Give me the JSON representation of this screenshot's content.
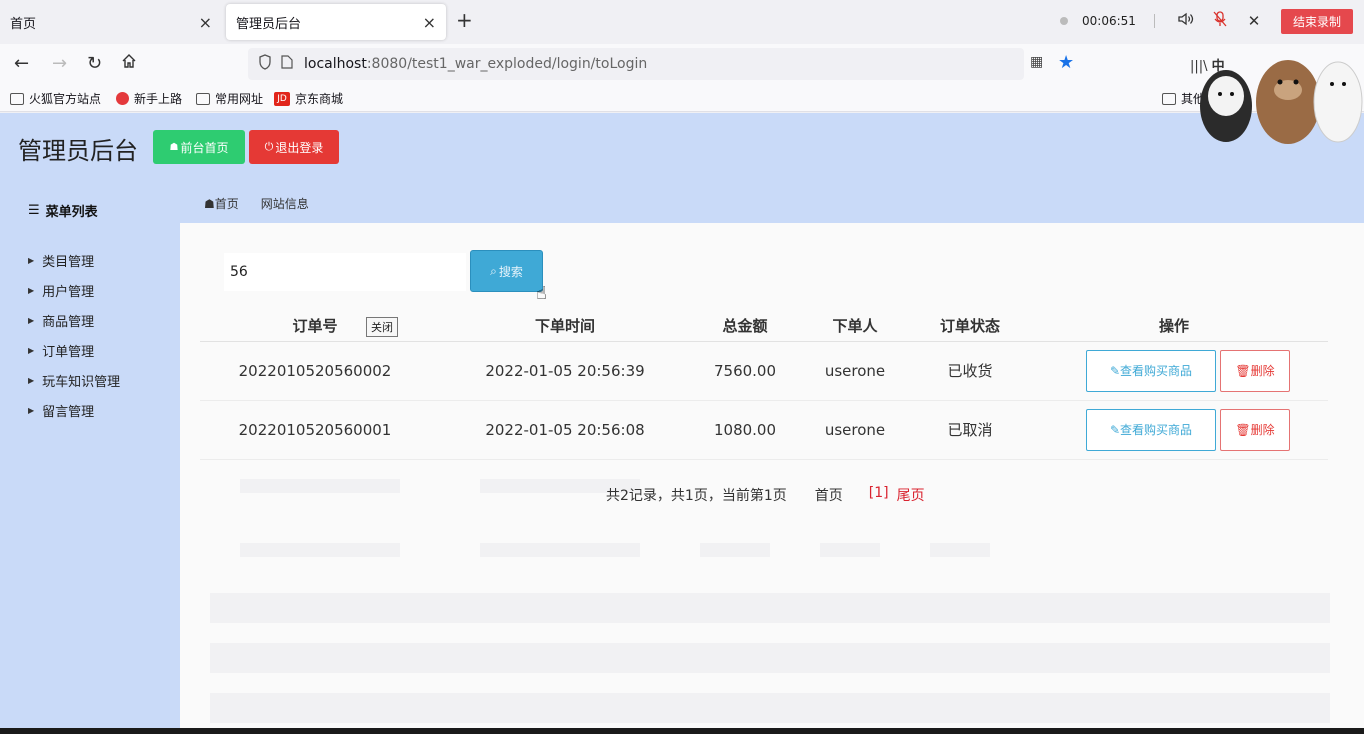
{
  "browser": {
    "tabs": [
      {
        "label": "首页",
        "active": false
      },
      {
        "label": "管理员后台",
        "active": true
      }
    ],
    "recording": {
      "time": "00:06:51",
      "stop_label": "结束录制"
    },
    "url": {
      "host": "localhost",
      "rest": ":8080/test1_war_exploded/login/toLogin"
    },
    "library_label": "中",
    "bookmarks": [
      "火狐官方站点",
      "新手上路",
      "常用网址",
      "京东商城"
    ],
    "other_bookmarks": "其他书签"
  },
  "header": {
    "title": "管理员后台",
    "home_button": "前台首页",
    "logout_button": "退出登录"
  },
  "sidebar": {
    "header": "菜单列表",
    "items": [
      {
        "label": "类目管理"
      },
      {
        "label": "用户管理"
      },
      {
        "label": "商品管理"
      },
      {
        "label": "订单管理"
      },
      {
        "label": "玩车知识管理"
      },
      {
        "label": "留言管理"
      }
    ]
  },
  "breadcrumb": {
    "home": "首页",
    "current": "网站信息"
  },
  "search": {
    "value": "56",
    "button": "搜索",
    "tooltip": "关闭"
  },
  "table": {
    "headers": [
      "订单号",
      "下单时间",
      "总金额",
      "下单人",
      "订单状态",
      "操作"
    ],
    "rows": [
      {
        "order_no": "2022010520560002",
        "time": "2022-01-05 20:56:39",
        "amount": "7560.00",
        "user": "userone",
        "status": "已收货",
        "view": "查看购买商品",
        "delete": "删除"
      },
      {
        "order_no": "2022010520560001",
        "time": "2022-01-05 20:56:08",
        "amount": "1080.00",
        "user": "userone",
        "status": "已取消",
        "view": "查看购买商品",
        "delete": "删除"
      }
    ]
  },
  "pagination": {
    "summary": "共2记录，共1页，当前第1页",
    "first": "首页",
    "current": "[1]",
    "last": "尾页"
  },
  "colors": {
    "page_bg": "#c9daf8",
    "green": "#2ecc71",
    "red": "#e53935",
    "blue": "#3fa9d6",
    "status_red": "#d9232f"
  }
}
